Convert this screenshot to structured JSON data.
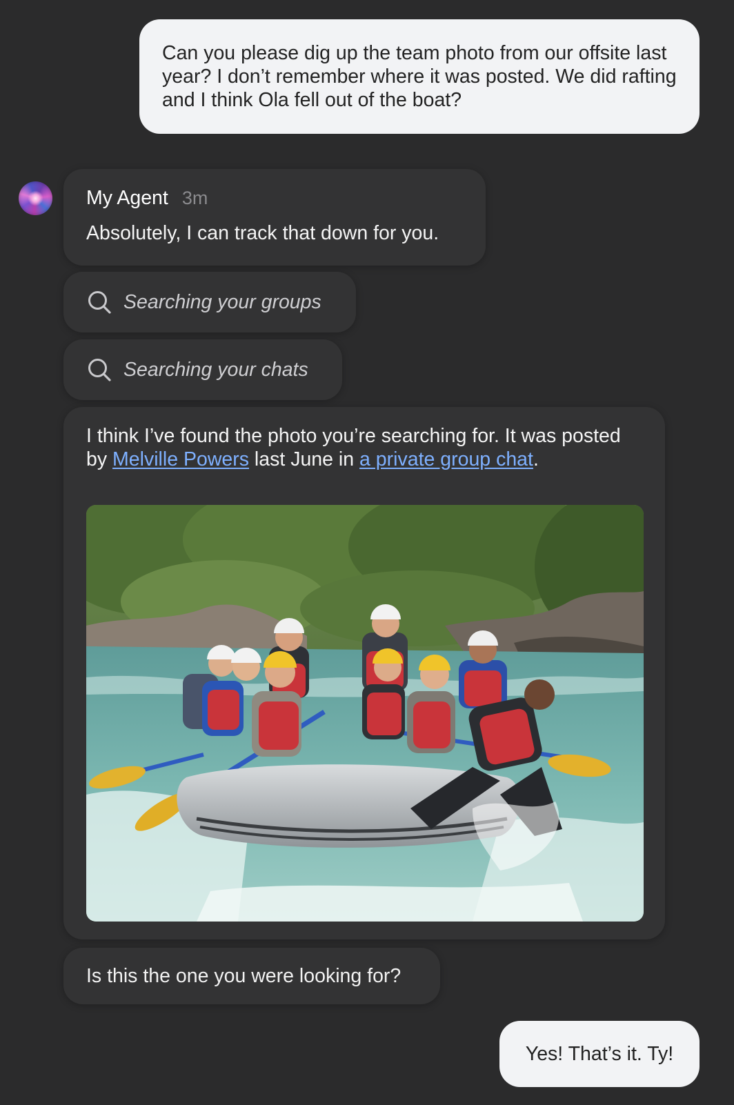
{
  "conversation": {
    "user_message_1": "Can you please dig up the team photo from our offsite last year? I don’t remember where it was posted. We did rafting and I think Ola fell out of the boat?",
    "agent": {
      "name": "My Agent",
      "time": "3m",
      "greeting": "Absolutely, I can track that down for you."
    },
    "status": [
      {
        "label": "Searching your groups",
        "icon": "search-icon"
      },
      {
        "label": "Searching your chats",
        "icon": "search-icon"
      }
    ],
    "found": {
      "text_before": "I think I’ve found the photo you’re searching for. It was posted by ",
      "person_link": "Melville Powers",
      "text_middle": " last June in ",
      "chat_link": "a private group chat",
      "text_after": "."
    },
    "question": "Is this the one you were looking for?",
    "user_message_2": "Yes! That’s it. Ty!"
  },
  "colors": {
    "background": "#2b2b2c",
    "agent_bubble": "#333334",
    "user_bubble": "#f2f3f5",
    "link": "#7eb0ff",
    "muted": "#8a8a8d"
  }
}
